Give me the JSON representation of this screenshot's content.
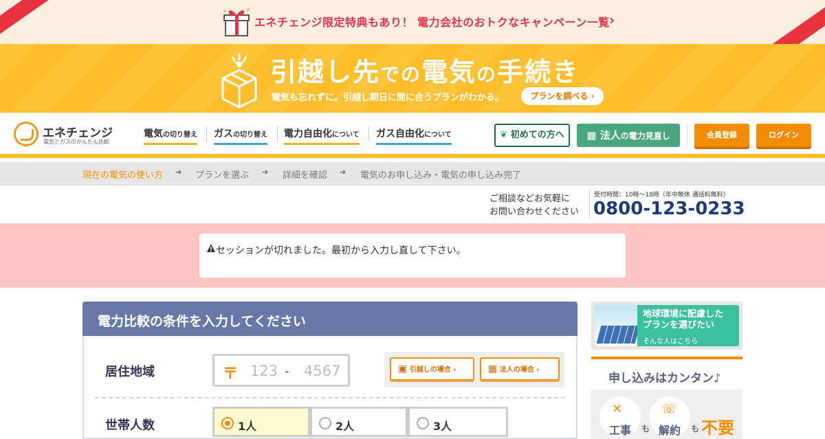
{
  "top_banner": {
    "text": "エネチェンジ限定特典もあり！ 電力会社のおトクなキャンペーン一覧"
  },
  "hero": {
    "title_a": "引越し先",
    "title_b": "での",
    "title_c": "電気",
    "title_d": "の",
    "title_e": "手続き",
    "subtitle": "電気も忘れずに。引越し期日に間に合うプランがわかる。",
    "button": "プランを調べる"
  },
  "logo": {
    "name": "エネチェンジ",
    "tagline": "電気とガスのかんたん比較"
  },
  "nav": {
    "items": [
      {
        "main": "電気",
        "sub": "の切り替え"
      },
      {
        "main": "ガス",
        "sub": "の切り替え"
      },
      {
        "main": "電力自由化",
        "sub": "について"
      },
      {
        "main": "ガス自由化",
        "sub": "について"
      }
    ],
    "first_btn": "初めての方へ",
    "corp_btn_a": "法人",
    "corp_btn_b": "の電力見直し",
    "register_btn": "会員登録",
    "login_btn": "ログイン"
  },
  "steps": [
    "現在の電気の使い方",
    "プランを選ぶ",
    "詳細を確認",
    "電気のお申し込み・電気の申し込み完了"
  ],
  "contact": {
    "line1": "ご相談などお気軽に",
    "line2": "お問い合わせください",
    "hours": "受付時間：10時〜18時（年中無休 通話料無料）",
    "tel": "0800-123-0233"
  },
  "alert": {
    "message": "セッションが切れました。最初から入力し直して下さい。"
  },
  "form": {
    "title": "電力比較の条件を入力してください",
    "region_label": "居住地域",
    "zip_mark": "〒",
    "zip_placeholder_1": "123",
    "zip_dash": "-",
    "zip_placeholder_2": "4567",
    "move_btn": "引越しの場合",
    "corp_btn": "法人の場合",
    "household_label": "世帯人数",
    "household_options": [
      "1人",
      "2人",
      "3人"
    ],
    "household_selected": "1人"
  },
  "sidebar": {
    "eco_line1": "地球環境に配慮した",
    "eco_line2": "プランを選びたい",
    "eco_sub": "そんな人はこちら",
    "easy_title": "申し込みはカンタン♪",
    "item1": "工事",
    "item2": "解約",
    "mo": "も",
    "fuyo": "不要"
  },
  "colors": {
    "accent": "#f28c00",
    "brand_yellow": "#fbbd2a",
    "header_blue": "#6878a6",
    "alert_bg": "#ffc4c4",
    "tel": "#1a3a7a"
  }
}
